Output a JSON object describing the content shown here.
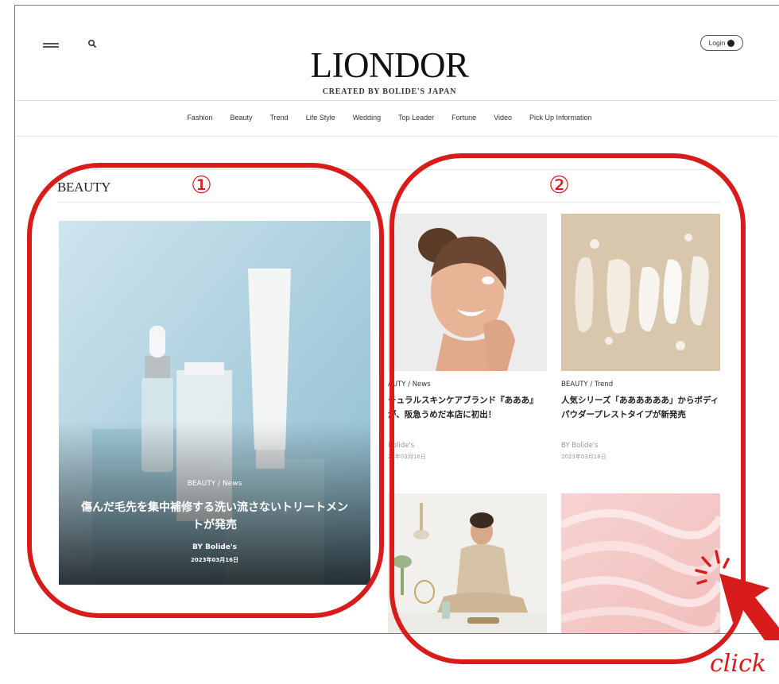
{
  "header": {
    "logo": "LIONDOR",
    "tagline": "CREATED BY BOLIDE'S JAPAN",
    "login_label": "Login"
  },
  "nav": {
    "items": [
      "Fashion",
      "Beauty",
      "Trend",
      "Life Style",
      "Wedding",
      "Top Leader",
      "Fortune",
      "Video",
      "Pick Up Information"
    ]
  },
  "section": {
    "title": "BEAUTY"
  },
  "featured": {
    "category": "BEAUTY / News",
    "title": "傷んだ毛先を集中補修する洗い流さないトリートメントが発売",
    "author": "BY  Bolide's",
    "date": "2023年03月16日"
  },
  "cards": [
    {
      "category": "AUTY / News",
      "title": "チュラルスキンケアブランド『あああ』が、阪急うめだ本店に初出！",
      "author": "Bolide's",
      "date": "23年03月16日"
    },
    {
      "category": "BEAUTY / Trend",
      "title": "人気シリーズ「ああああああ」からボディパウダープレストタイプが新発売",
      "author": "BY  Bolide's",
      "date": "2023年03月16日"
    }
  ],
  "annotations": {
    "marker1": "①",
    "marker2": "②",
    "click": "click",
    "color": "#d81b1b"
  },
  "icons": [
    "hamburger-icon",
    "search-icon",
    "user-icon",
    "pointer-arrow-icon"
  ]
}
